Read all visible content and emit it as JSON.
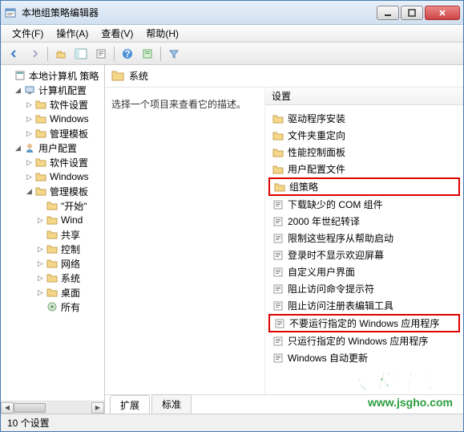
{
  "window": {
    "title": "本地组策略编辑器"
  },
  "menu": {
    "file": "文件(F)",
    "action": "操作(A)",
    "view": "查看(V)",
    "help": "帮助(H)"
  },
  "tree": {
    "root": "本地计算机 策略",
    "computer_config": "计算机配置",
    "cc_software": "软件设置",
    "cc_windows": "Windows",
    "cc_admin": "管理模板",
    "user_config": "用户配置",
    "uc_software": "软件设置",
    "uc_windows": "Windows",
    "uc_admin": "管理模板",
    "start_menu": "\"开始\"",
    "wind": "Wind",
    "share": "共享",
    "control": "控制",
    "network": "网络",
    "system": "系统",
    "desktop": "桌面",
    "all": "所有"
  },
  "content": {
    "header_title": "系统",
    "description": "选择一个项目来查看它的描述。",
    "column_header": "设置"
  },
  "list_items": [
    {
      "type": "folder",
      "label": "驱动程序安装",
      "hl": false
    },
    {
      "type": "folder",
      "label": "文件夹重定向",
      "hl": false
    },
    {
      "type": "folder",
      "label": "性能控制面板",
      "hl": false
    },
    {
      "type": "folder",
      "label": "用户配置文件",
      "hl": false
    },
    {
      "type": "folder",
      "label": "组策略",
      "hl": true
    },
    {
      "type": "setting",
      "label": "下载缺少的 COM 组件",
      "hl": false
    },
    {
      "type": "setting",
      "label": "2000 年世纪转译",
      "hl": false
    },
    {
      "type": "setting",
      "label": "限制这些程序从帮助启动",
      "hl": false
    },
    {
      "type": "setting",
      "label": "登录时不显示欢迎屏幕",
      "hl": false
    },
    {
      "type": "setting",
      "label": "自定义用户界面",
      "hl": false
    },
    {
      "type": "setting",
      "label": "阻止访问命令提示符",
      "hl": false
    },
    {
      "type": "setting",
      "label": "阻止访问注册表编辑工具",
      "hl": false
    },
    {
      "type": "setting",
      "label": "不要运行指定的 Windows 应用程序",
      "hl": true
    },
    {
      "type": "setting",
      "label": "只运行指定的 Windows 应用程序",
      "hl": false
    },
    {
      "type": "setting",
      "label": "Windows 自动更新",
      "hl": false
    }
  ],
  "tabs": {
    "extended": "扩展",
    "standard": "标准"
  },
  "status": {
    "count": "10 个设置"
  },
  "watermark": {
    "line1": "技术员联盟",
    "line2": "www.jsgho.com"
  }
}
